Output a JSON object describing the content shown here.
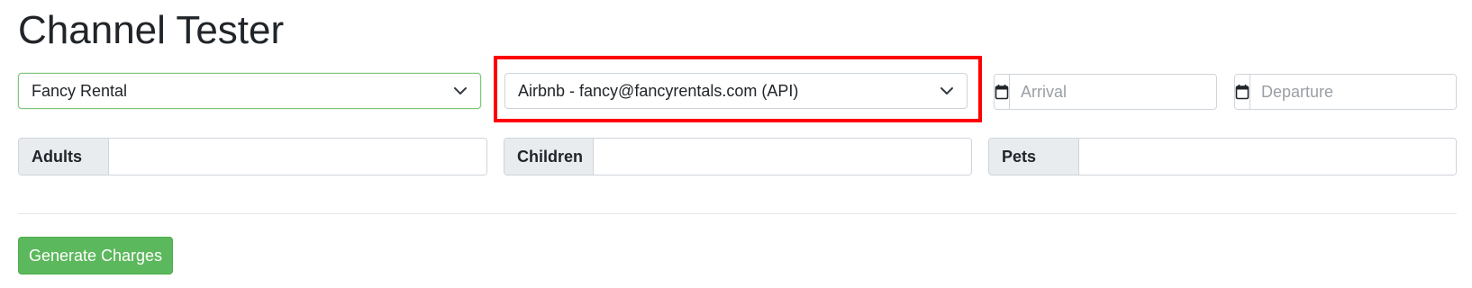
{
  "page": {
    "title": "Channel Tester"
  },
  "filters": {
    "property_select": {
      "value": "Fancy Rental",
      "icon": "chevron-down-icon"
    },
    "channel_select": {
      "value": "Airbnb - fancy@fancyrentals.com (API)",
      "icon": "chevron-down-icon"
    },
    "arrival": {
      "placeholder": "Arrival",
      "icon": "calendar-icon"
    },
    "departure": {
      "placeholder": "Departure",
      "icon": "calendar-icon"
    }
  },
  "guests": {
    "adults_label": "Adults",
    "children_label": "Children",
    "pets_label": "Pets"
  },
  "actions": {
    "generate_label": "Generate Charges"
  },
  "colors": {
    "success": "#5cb85c",
    "highlight": "#ff0000",
    "addon_bg": "#e9ecef",
    "border": "#ced4da"
  }
}
